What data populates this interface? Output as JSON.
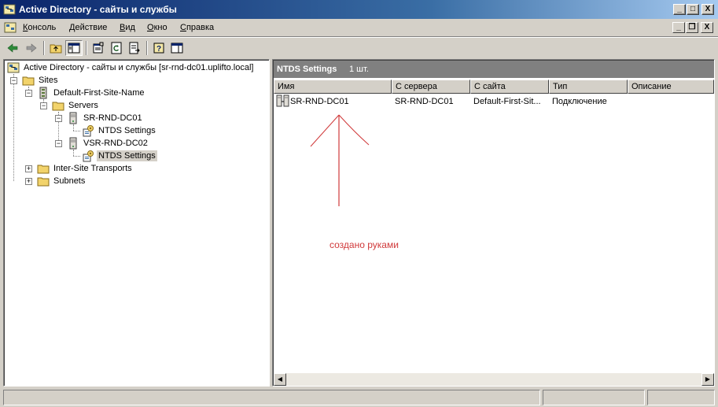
{
  "window": {
    "title": "Active Directory - сайты и службы",
    "controls": {
      "minimize": "_",
      "maximize": "□",
      "close": "X"
    }
  },
  "menubar": {
    "items": [
      {
        "label": "Консоль",
        "accel": "К",
        "rest": "онсоль"
      },
      {
        "label": "Действие",
        "accel": "Д",
        "rest": "ействие"
      },
      {
        "label": "Вид",
        "accel": "В",
        "rest": "ид"
      },
      {
        "label": "Окно",
        "accel": "О",
        "rest": "кно"
      },
      {
        "label": "Справка",
        "accel": "С",
        "rest": "правка"
      }
    ],
    "mdi_controls": {
      "minimize": "_",
      "restore": "❐",
      "close": "X"
    }
  },
  "toolbar": {
    "buttons": [
      "back-icon",
      "forward-icon",
      "up-folder-icon",
      "show-hide-tree-icon",
      "properties-icon",
      "refresh-icon",
      "export-list-icon",
      "help-icon",
      "action-pane-icon"
    ]
  },
  "tree": {
    "root": "Active Directory - сайты и службы [sr-rnd-dc01.uplifto.local]",
    "nodes": [
      {
        "label": "Sites",
        "icon": "folder-icon",
        "expander": "−"
      },
      {
        "label": "Default-First-Site-Name",
        "icon": "site-icon",
        "expander": "−"
      },
      {
        "label": "Servers",
        "icon": "folder-icon",
        "expander": "−"
      },
      {
        "label": "SR-RND-DC01",
        "icon": "server-icon",
        "expander": "−"
      },
      {
        "label": "NTDS Settings",
        "icon": "ntds-settings-icon",
        "expander": ""
      },
      {
        "label": "VSR-RND-DC02",
        "icon": "server-icon",
        "expander": "−"
      },
      {
        "label": "NTDS Settings",
        "icon": "ntds-settings-icon",
        "expander": "",
        "selected": true
      },
      {
        "label": "Inter-Site Transports",
        "icon": "folder-icon",
        "expander": "+"
      },
      {
        "label": "Subnets",
        "icon": "folder-icon",
        "expander": "+"
      }
    ]
  },
  "details": {
    "title": "NTDS Settings",
    "count": "1 шт.",
    "columns": [
      "Имя",
      "С сервера",
      "С сайта",
      "Тип",
      "Описание"
    ],
    "rows": [
      {
        "name": "SR-RND-DC01",
        "from_server": "SR-RND-DC01",
        "from_site": "Default-First-Sit...",
        "type": "Подключение",
        "description": ""
      }
    ]
  },
  "annotation": {
    "text": "создано руками",
    "color": "#d0393a"
  },
  "scrollbar": {
    "left_arrow": "◀",
    "right_arrow": "▶"
  },
  "colors": {
    "titlebar_start": "#0a246a",
    "titlebar_end": "#a6caf0",
    "face": "#d4d0c8",
    "pane_header": "#808080"
  }
}
